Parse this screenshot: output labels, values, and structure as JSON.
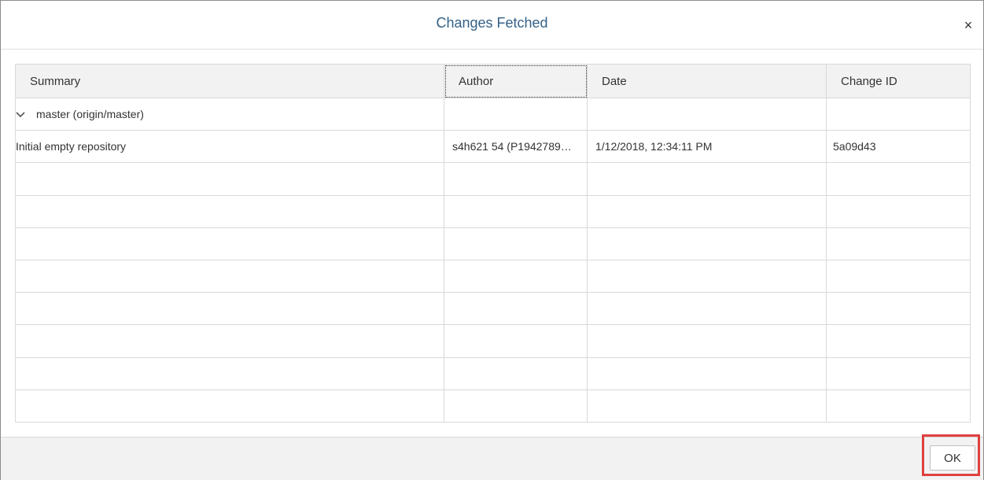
{
  "dialog": {
    "title": "Changes Fetched",
    "close_label": "×"
  },
  "table": {
    "columns": [
      "Summary",
      "Author",
      "Date",
      "Change ID"
    ],
    "branch": {
      "label": "master (origin/master)",
      "expanded": true
    },
    "rows": [
      {
        "summary": "Initial empty repository",
        "author": "s4h621 54 (P1942789…",
        "date": "1/12/2018, 12:34:11 PM",
        "change_id": "5a09d43"
      }
    ]
  },
  "footer": {
    "ok_label": "OK"
  },
  "colors": {
    "title": "#346187",
    "highlight": "#e03f3f"
  }
}
